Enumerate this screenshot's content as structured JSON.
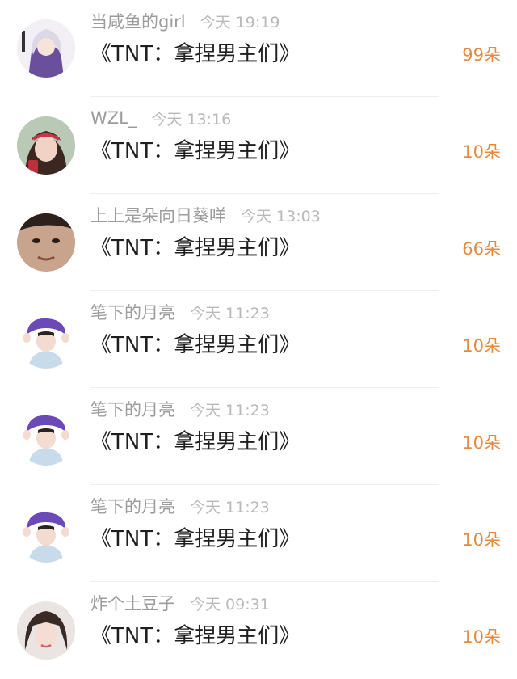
{
  "records": [
    {
      "username": "当咸鱼的girl",
      "time": "今天 19:19",
      "gift": "《TNT：拿捏男主们》",
      "count": "99朵",
      "avatar_icon": "anime-girl-avatar"
    },
    {
      "username": "WZL_",
      "time": "今天 13:16",
      "gift": "《TNT：拿捏男主们》",
      "count": "10朵",
      "avatar_icon": "girl-headband-avatar"
    },
    {
      "username": "上上是朵向日葵咩",
      "time": "今天 13:03",
      "gift": "《TNT：拿捏男主们》",
      "count": "66朵",
      "avatar_icon": "face-closeup-avatar"
    },
    {
      "username": "笔下的月亮",
      "time": "今天 11:23",
      "gift": "《TNT：拿捏男主们》",
      "count": "10朵",
      "avatar_icon": "boy-purple-hat-avatar"
    },
    {
      "username": "笔下的月亮",
      "time": "今天 11:23",
      "gift": "《TNT：拿捏男主们》",
      "count": "10朵",
      "avatar_icon": "boy-purple-hat-avatar"
    },
    {
      "username": "笔下的月亮",
      "time": "今天 11:23",
      "gift": "《TNT：拿捏男主们》",
      "count": "10朵",
      "avatar_icon": "boy-purple-hat-avatar"
    },
    {
      "username": "炸个土豆子",
      "time": "今天 09:31",
      "gift": "《TNT：拿捏男主们》",
      "count": "10朵",
      "avatar_icon": "girl-short-hair-avatar"
    }
  ]
}
